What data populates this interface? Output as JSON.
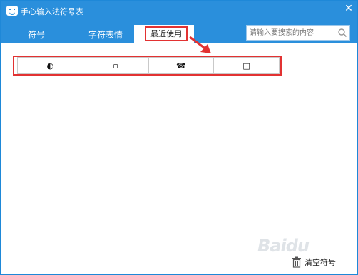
{
  "window": {
    "title": "手心输入法符号表",
    "minimize_glyph": "—",
    "close_glyph": "✕"
  },
  "tabs": [
    {
      "label": "符号"
    },
    {
      "label": "字符表情"
    },
    {
      "label": "最近使用",
      "active": true
    }
  ],
  "search": {
    "placeholder": "请输入要搜索的内容",
    "value": ""
  },
  "recent_symbols": [
    "◐",
    "▫",
    "☎",
    "□"
  ],
  "footer": {
    "clear_label": "清空符号"
  },
  "watermark": {
    "text": "Baidu"
  },
  "colors": {
    "titlebar": "#2a8fdc",
    "highlight": "#e23232"
  }
}
